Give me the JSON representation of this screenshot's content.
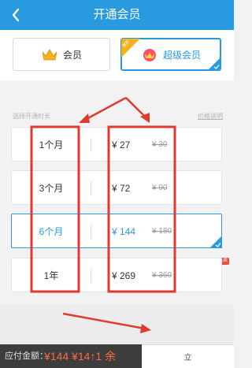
{
  "header": {
    "title": "开通会员"
  },
  "membership_types": [
    {
      "label": "会员",
      "selected": false
    },
    {
      "label": "超级会员",
      "selected": true,
      "tag": "推荐"
    }
  ],
  "duration_section": {
    "label": "选择开通时长",
    "help_link": "价格说明"
  },
  "plans": [
    {
      "duration": "1个月",
      "price": "¥ 27",
      "original_price": "¥ 30",
      "selected": false
    },
    {
      "duration": "3个月",
      "price": "¥ 72",
      "original_price": "¥ 90",
      "selected": false
    },
    {
      "duration": "6个月",
      "price": "¥ 144",
      "original_price": "¥ 180",
      "selected": true
    },
    {
      "duration": "1年",
      "price": "¥ 269",
      "original_price": "¥ 360",
      "selected": false
    }
  ],
  "hot_badge": "热卖",
  "footer": {
    "amount_label": "应付金额：",
    "amount_value": "¥144 ¥14↑1 余",
    "pay_button": "立"
  },
  "colors": {
    "primary": "#2a9ae0",
    "annotation": "#e03a2f",
    "footer_bg": "#3d3d3d",
    "amount": "#ff6a3d"
  }
}
